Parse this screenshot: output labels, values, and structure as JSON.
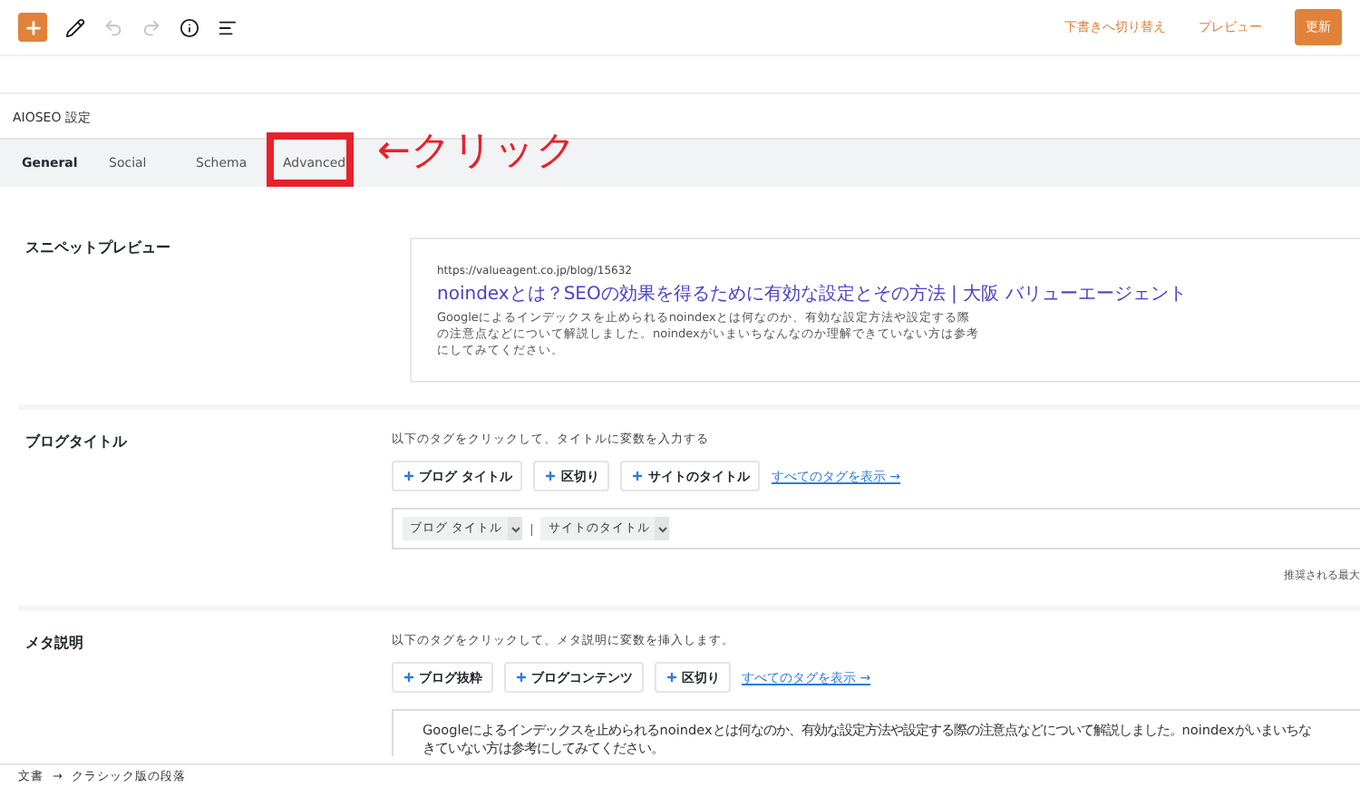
{
  "toolbar": {
    "tools": [
      {
        "kind": "add",
        "disabled": false
      },
      {
        "kind": "edit",
        "disabled": false
      },
      {
        "kind": "undo",
        "disabled": true
      },
      {
        "kind": "redo",
        "disabled": true
      },
      {
        "kind": "info",
        "disabled": false
      },
      {
        "kind": "outline",
        "disabled": false
      }
    ],
    "switch_to_draft": "下書きへ切り替え",
    "preview": "プレビュー",
    "update": "更新"
  },
  "panel": {
    "title": "AIOSEO 設定",
    "tabs": [
      {
        "label": "General",
        "selected": true
      },
      {
        "label": "Social",
        "selected": false
      },
      {
        "label": "Schema",
        "selected": false
      },
      {
        "label": "Advanced",
        "selected": false,
        "highlighted": true
      }
    ],
    "annotation": {
      "text": "←クリック"
    }
  },
  "snippet_preview": {
    "label": "スニペットプレビュー",
    "url": "https://valueagent.co.jp/blog/15632",
    "title": "noindexとは？SEOの効果を得るために有効な設定とその方法 | 大阪 バリューエージェント",
    "description": "Googleによるインデックスを止められるnoindexとは何なのか、有効な設定方法や設定する際の注意点などについて解説しました。noindexがいまいちなんなのか理解できていない方は参考にしてみてください。"
  },
  "blog_title": {
    "label": "ブログタイトル",
    "help": "以下のタグをクリックして、タイトルに変数を入力する",
    "tags": [
      "ブログ タイトル",
      "区切り",
      "サイトのタイトル"
    ],
    "show_all": "すべてのタグを表示 →",
    "value_tokens": [
      {
        "kind": "tag",
        "text": "ブログ タイトル"
      },
      {
        "kind": "separator",
        "text": "|"
      },
      {
        "kind": "tag",
        "text": "サイトのタイトル"
      }
    ],
    "note": "推奨される最大"
  },
  "meta_description": {
    "label": "メタ説明",
    "help": "以下のタグをクリックして、メタ説明に変数を挿入します。",
    "tags": [
      "ブログ抜粋",
      "ブログコンテンツ",
      "区切り"
    ],
    "show_all": "すべてのタグを表示 →",
    "value_lines": [
      "Googleによるインデックスを止められるnoindexとは何なのか、有効な設定方法や設定する際の注意点などについて解説しました。noindexがいまいちな",
      "きていない方は参考にしてみてください。"
    ]
  },
  "breadcrumb": {
    "items": [
      "文書",
      "クラシック版の段落"
    ],
    "separator": "→"
  }
}
